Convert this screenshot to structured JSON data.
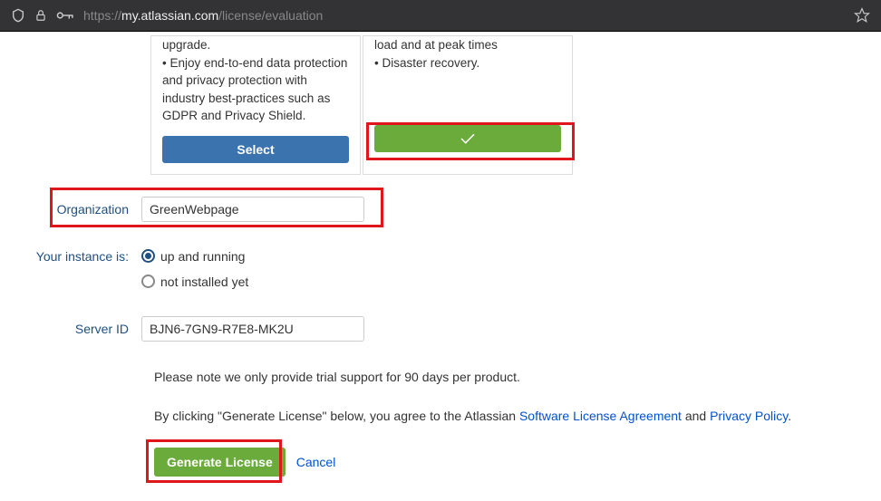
{
  "browser": {
    "url_prefix": "https://",
    "url_domain": "my.atlassian.com",
    "url_path": "/license/evaluation"
  },
  "cards": {
    "left": {
      "lines": [
        "upgrade.",
        "• Enjoy end-to-end data protection and privacy protection with industry best-practices such as GDPR and Privacy Shield."
      ],
      "button": "Select"
    },
    "right": {
      "lines": [
        "load and at peak times",
        "• Disaster recovery."
      ]
    }
  },
  "form": {
    "org_label": "Organization",
    "org_value": "GreenWebpage",
    "instance_label": "Your instance is:",
    "radio_running": "up and running",
    "radio_not_installed": "not installed yet",
    "server_id_label": "Server ID",
    "server_id_value": "BJN6-7GN9-R7E8-MK2U"
  },
  "notes": {
    "trial": "Please note we only provide trial support for 90 days per product.",
    "agree_prefix": "By clicking \"Generate License\" below, you agree to the Atlassian ",
    "license_link": "Software License Agreement",
    "agree_mid": " and ",
    "privacy_link": "Privacy Policy",
    "agree_suffix": "."
  },
  "actions": {
    "generate": "Generate License",
    "cancel": "Cancel"
  }
}
